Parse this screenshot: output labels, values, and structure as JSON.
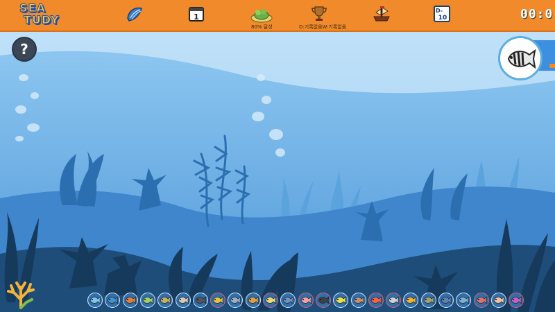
{
  "logo": {
    "line1": "SEA",
    "line2": "TUDY"
  },
  "toolbar": {
    "shell_icon": "shell-icon",
    "calendar_icon": "calendar-icon",
    "calendar_day": "1",
    "island_icon": "island-icon",
    "progress_label": "80% 달성",
    "progress_value": 80,
    "trophy_icon": "trophy-icon",
    "record_label": "D:기록없음W:기록없음",
    "ship_icon": "ship-icon",
    "dday_icon": "dday-icon",
    "dday_top": "D-",
    "dday_num": "10",
    "timer": "00:0"
  },
  "help": {
    "label": "?"
  },
  "colors": {
    "topbar": "#f08a2a",
    "sky_top": "#bfe0f8",
    "water_mid": "#6db3ea",
    "sea_dark": "#1e4d7a",
    "seaweed_dark": "#163a5c",
    "accent_blue": "#3d8fe0"
  },
  "tray": {
    "slots": [
      {
        "color": "#7ec7e8",
        "border": "normal"
      },
      {
        "color": "#4a90c8",
        "border": "normal"
      },
      {
        "color": "#e0803a",
        "border": "normal"
      },
      {
        "color": "#9fd06a",
        "border": "normal"
      },
      {
        "color": "#c8b060",
        "border": "normal"
      },
      {
        "color": "#d8c8b0",
        "border": "normal"
      },
      {
        "color": "#555555",
        "border": "normal"
      },
      {
        "color": "#e8c040",
        "border": "red"
      },
      {
        "color": "#9ab0c0",
        "border": "normal"
      },
      {
        "color": "#e0a040",
        "border": "normal"
      },
      {
        "color": "#f0d870",
        "border": "red"
      },
      {
        "color": "#7090c0",
        "border": "normal"
      },
      {
        "color": "#f0a0a0",
        "border": "red"
      },
      {
        "color": "#404040",
        "border": "red"
      },
      {
        "color": "#e8e050",
        "border": "normal"
      },
      {
        "color": "#c09070",
        "border": "normal"
      },
      {
        "color": "#ff6040",
        "border": "red"
      },
      {
        "color": "#d0d0d0",
        "border": "red"
      },
      {
        "color": "#f0b030",
        "border": "normal"
      },
      {
        "color": "#a0a070",
        "border": "normal"
      },
      {
        "color": "#6080b0",
        "border": "normal"
      },
      {
        "color": "#80b0d0",
        "border": "normal"
      },
      {
        "color": "#e07070",
        "border": "red"
      },
      {
        "color": "#f0c0a0",
        "border": "normal"
      },
      {
        "color": "#c060c0",
        "border": "red"
      }
    ]
  }
}
